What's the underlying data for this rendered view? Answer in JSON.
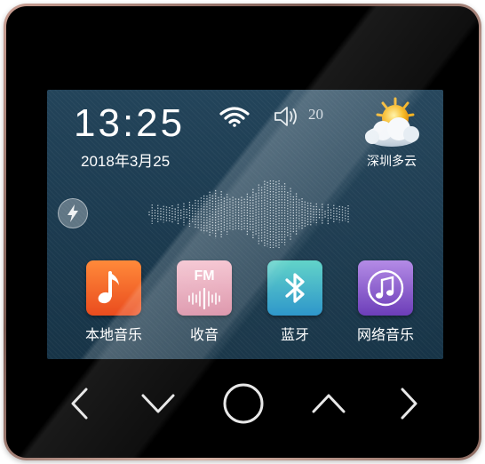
{
  "status": {
    "time": "13:25",
    "date": "2018年3月25",
    "volume": "20",
    "city": "深圳多云",
    "weather_icon": "partly-cloudy-icon"
  },
  "apps": [
    {
      "label": "本地音乐",
      "icon": "music-note-icon",
      "color": "#f26a2d"
    },
    {
      "label": "收音",
      "icon": "fm-radio-icon",
      "tile_text": "FM",
      "color": "#e59aae"
    },
    {
      "label": "蓝牙",
      "icon": "bluetooth-icon",
      "color": "#36b6c4"
    },
    {
      "label": "网络音乐",
      "icon": "network-music-icon",
      "color": "#8a55c9"
    }
  ],
  "hardware_buttons": [
    "back-arrow-icon",
    "down-arrow-icon",
    "home-circle-icon",
    "up-arrow-icon",
    "forward-arrow-icon"
  ]
}
